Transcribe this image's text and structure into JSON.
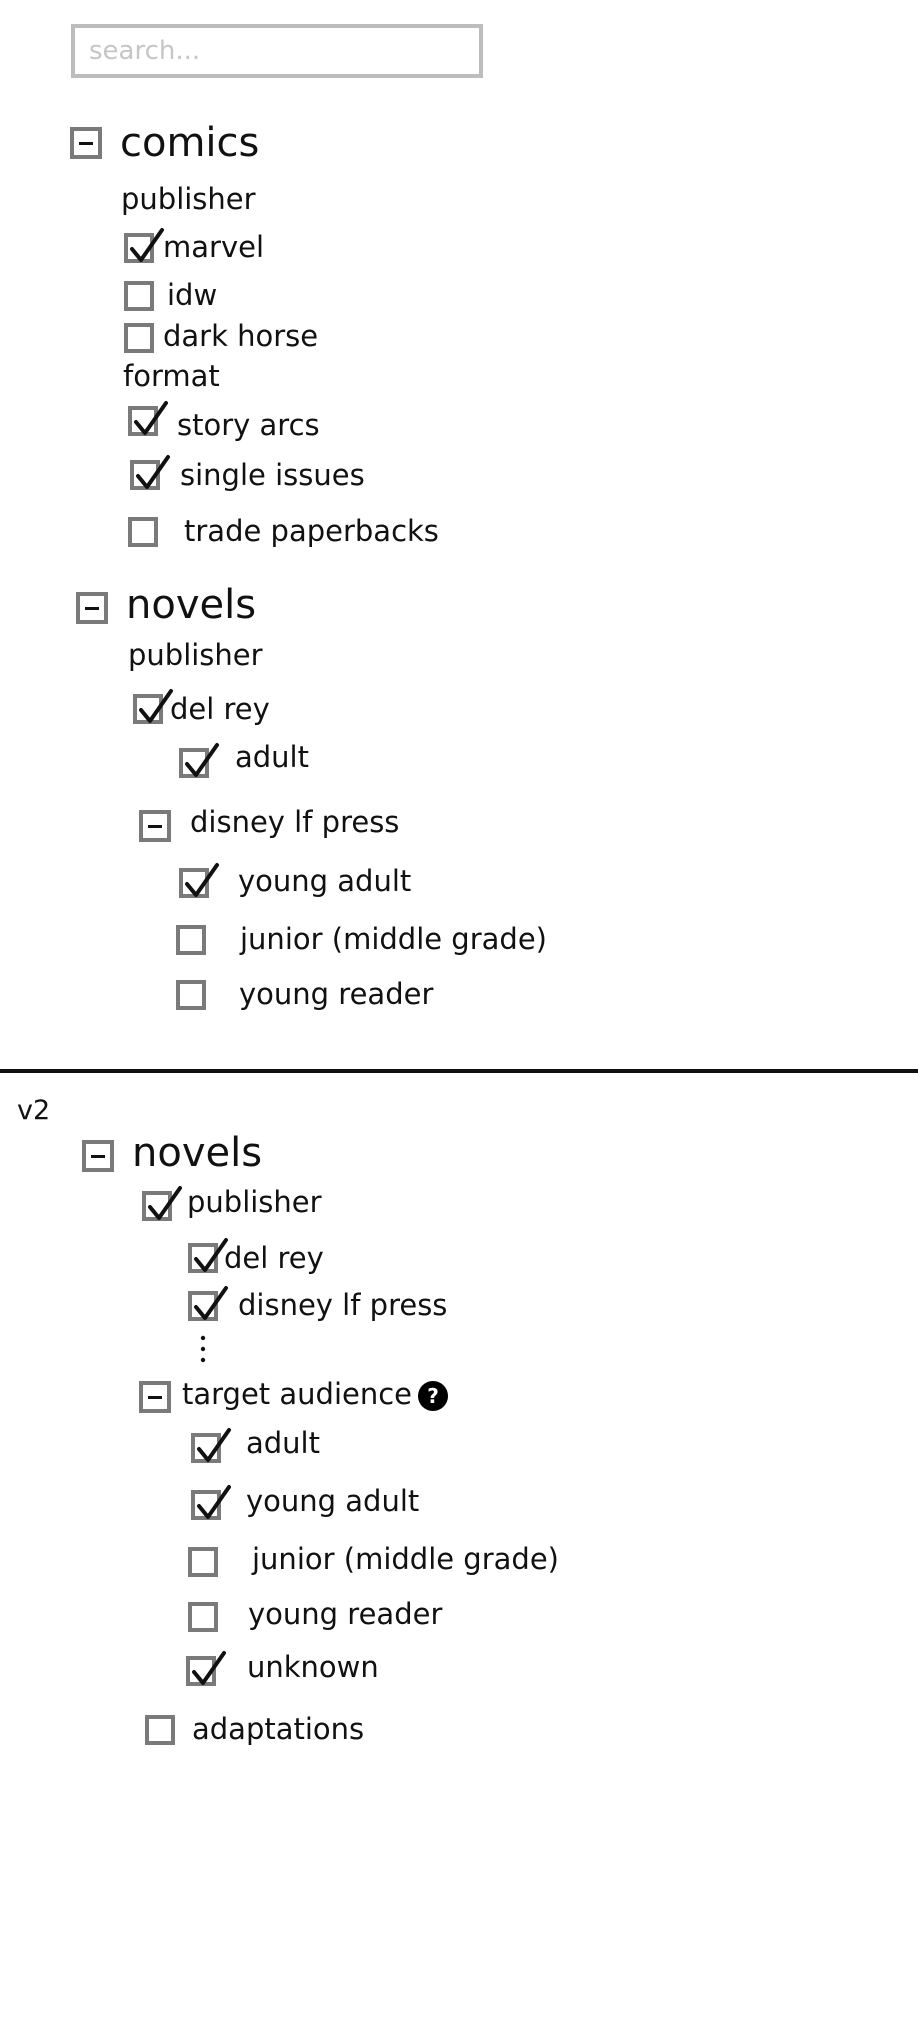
{
  "search": {
    "placeholder": "search..."
  },
  "v1": {
    "comics": {
      "title": "comics",
      "publisher_heading": "publisher",
      "publishers": [
        {
          "label": "marvel",
          "checked": true
        },
        {
          "label": "idw",
          "checked": false
        },
        {
          "label": "dark horse",
          "checked": false
        }
      ],
      "format_heading": "format",
      "formats": [
        {
          "label": "story arcs",
          "checked": true
        },
        {
          "label": "single issues",
          "checked": true
        },
        {
          "label": "trade paperbacks",
          "checked": false
        }
      ]
    },
    "novels": {
      "title": "novels",
      "publisher_heading": "publisher",
      "del_rey": {
        "label": "del rey",
        "checked": true
      },
      "del_rey_children": [
        {
          "label": "adult",
          "checked": true
        }
      ],
      "disney": {
        "label": "disney lf press",
        "expanded": true
      },
      "disney_children": [
        {
          "label": "young adult",
          "checked": true
        },
        {
          "label": "junior (middle grade)",
          "checked": false
        },
        {
          "label": "young reader",
          "checked": false
        }
      ]
    }
  },
  "v2": {
    "version_label": "v2",
    "novels": {
      "title": "novels",
      "publisher": {
        "label": "publisher",
        "checked": true
      },
      "publishers": [
        {
          "label": "del rey",
          "checked": true
        },
        {
          "label": "disney lf press",
          "checked": true
        }
      ],
      "more_indicator": "⋮",
      "target_audience": {
        "label": "target audience",
        "expanded": true,
        "help_icon": "?"
      },
      "audiences": [
        {
          "label": "adult",
          "checked": true
        },
        {
          "label": "young adult",
          "checked": true
        },
        {
          "label": "junior (middle grade)",
          "checked": false
        },
        {
          "label": "young reader",
          "checked": false
        },
        {
          "label": "unknown",
          "checked": true
        }
      ],
      "adaptations": {
        "label": "adaptations",
        "checked": false
      }
    }
  },
  "colors": {
    "checkbox_border": "#7a7a7a",
    "search_border": "#bdbdbd",
    "placeholder": "#c6c6c6",
    "text": "#111111",
    "divider": "#111111"
  }
}
